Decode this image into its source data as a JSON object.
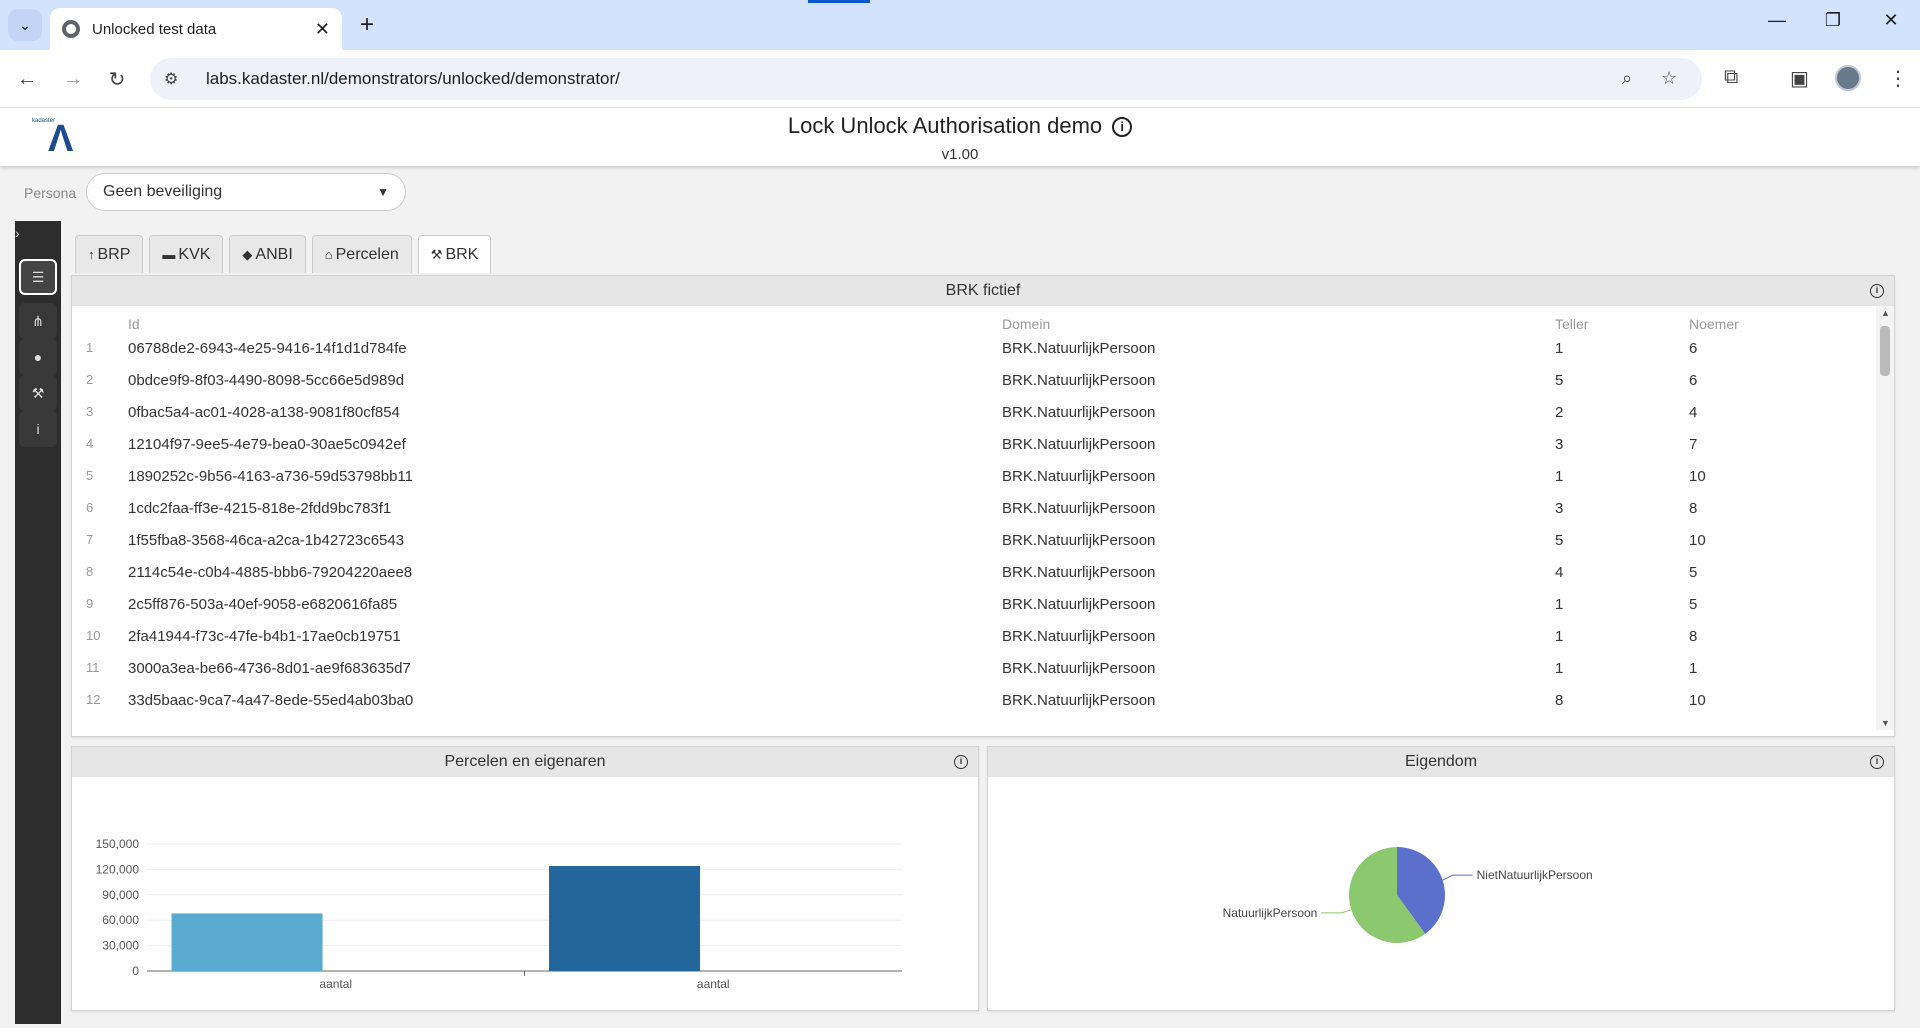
{
  "browser": {
    "tab_title": "Unlocked test data",
    "url": "labs.kadaster.nl/demonstrators/unlocked/demonstrator/"
  },
  "app": {
    "logo_small": "kadaster",
    "title": "Lock Unlock Authorisation demo",
    "version": "v1.00"
  },
  "persona": {
    "label": "Persona",
    "selected": "Geen beveiliging"
  },
  "sidebar": {
    "items": [
      "database-icon",
      "sitemap-icon",
      "user-icon",
      "gavel-icon",
      "info-icon"
    ]
  },
  "tabs": [
    {
      "label": "BRP",
      "icon": "↑"
    },
    {
      "label": "KVK",
      "icon": "▬"
    },
    {
      "label": "ANBI",
      "icon": "◆"
    },
    {
      "label": "Percelen",
      "icon": "⌂"
    },
    {
      "label": "BRK",
      "icon": "⚒"
    }
  ],
  "table": {
    "title": "BRK fictief",
    "columns": [
      "Id",
      "Domein",
      "Teller",
      "Noemer"
    ],
    "rows": [
      {
        "n": "1",
        "id": "06788de2-6943-4e25-9416-14f1d1d784fe",
        "domein": "BRK.NatuurlijkPersoon",
        "teller": "1",
        "noemer": "6"
      },
      {
        "n": "2",
        "id": "0bdce9f9-8f03-4490-8098-5cc66e5d989d",
        "domein": "BRK.NatuurlijkPersoon",
        "teller": "5",
        "noemer": "6"
      },
      {
        "n": "3",
        "id": "0fbac5a4-ac01-4028-a138-9081f80cf854",
        "domein": "BRK.NatuurlijkPersoon",
        "teller": "2",
        "noemer": "4"
      },
      {
        "n": "4",
        "id": "12104f97-9ee5-4e79-bea0-30ae5c0942ef",
        "domein": "BRK.NatuurlijkPersoon",
        "teller": "3",
        "noemer": "7"
      },
      {
        "n": "5",
        "id": "1890252c-9b56-4163-a736-59d53798bb11",
        "domein": "BRK.NatuurlijkPersoon",
        "teller": "1",
        "noemer": "10"
      },
      {
        "n": "6",
        "id": "1cdc2faa-ff3e-4215-818e-2fdd9bc783f1",
        "domein": "BRK.NatuurlijkPersoon",
        "teller": "3",
        "noemer": "8"
      },
      {
        "n": "7",
        "id": "1f55fba8-3568-46ca-a2ca-1b42723c6543",
        "domein": "BRK.NatuurlijkPersoon",
        "teller": "5",
        "noemer": "10"
      },
      {
        "n": "8",
        "id": "2114c54e-c0b4-4885-bbb6-79204220aee8",
        "domein": "BRK.NatuurlijkPersoon",
        "teller": "4",
        "noemer": "5"
      },
      {
        "n": "9",
        "id": "2c5ff876-503a-40ef-9058-e6820616fa85",
        "domein": "BRK.NatuurlijkPersoon",
        "teller": "1",
        "noemer": "5"
      },
      {
        "n": "10",
        "id": "2fa41944-f73c-47fe-b4b1-17ae0cb19751",
        "domein": "BRK.NatuurlijkPersoon",
        "teller": "1",
        "noemer": "8"
      },
      {
        "n": "11",
        "id": "3000a3ea-be66-4736-8d01-ae9f683635d7",
        "domein": "BRK.NatuurlijkPersoon",
        "teller": "1",
        "noemer": "1"
      },
      {
        "n": "12",
        "id": "33d5baac-9ca7-4a47-8ede-55ed4ab03ba0",
        "domein": "BRK.NatuurlijkPersoon",
        "teller": "8",
        "noemer": "10"
      }
    ]
  },
  "bar_panel": {
    "title": "Percelen en eigenaren"
  },
  "pie_panel": {
    "title": "Eigendom"
  },
  "chart_data": [
    {
      "type": "bar",
      "title": "Percelen en eigenaren",
      "categories": [
        "aantal",
        "aantal"
      ],
      "values": [
        68000,
        124000
      ],
      "colors": [
        "#5aabd1",
        "#22669b"
      ],
      "yticks": [
        "0",
        "30,000",
        "60,000",
        "90,000",
        "120,000",
        "150,000"
      ],
      "ylim": [
        0,
        150000
      ]
    },
    {
      "type": "pie",
      "title": "Eigendom",
      "slices": [
        {
          "label": "NietNatuurlijkPersoon",
          "value": 0.4,
          "color": "#5b6fcc"
        },
        {
          "label": "NatuurlijkPersoon",
          "value": 0.6,
          "color": "#8cc86d"
        }
      ]
    }
  ]
}
